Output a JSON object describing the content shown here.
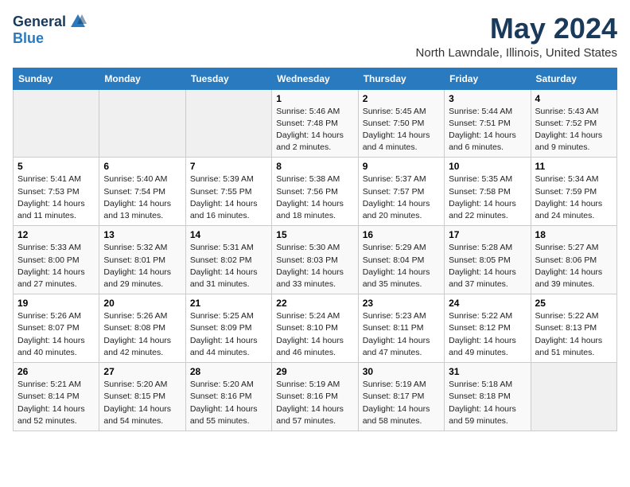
{
  "header": {
    "logo_general": "General",
    "logo_blue": "Blue",
    "month": "May 2024",
    "location": "North Lawndale, Illinois, United States"
  },
  "days_of_week": [
    "Sunday",
    "Monday",
    "Tuesday",
    "Wednesday",
    "Thursday",
    "Friday",
    "Saturday"
  ],
  "weeks": [
    [
      {
        "num": "",
        "info": ""
      },
      {
        "num": "",
        "info": ""
      },
      {
        "num": "",
        "info": ""
      },
      {
        "num": "1",
        "info": "Sunrise: 5:46 AM\nSunset: 7:48 PM\nDaylight: 14 hours\nand 2 minutes."
      },
      {
        "num": "2",
        "info": "Sunrise: 5:45 AM\nSunset: 7:50 PM\nDaylight: 14 hours\nand 4 minutes."
      },
      {
        "num": "3",
        "info": "Sunrise: 5:44 AM\nSunset: 7:51 PM\nDaylight: 14 hours\nand 6 minutes."
      },
      {
        "num": "4",
        "info": "Sunrise: 5:43 AM\nSunset: 7:52 PM\nDaylight: 14 hours\nand 9 minutes."
      }
    ],
    [
      {
        "num": "5",
        "info": "Sunrise: 5:41 AM\nSunset: 7:53 PM\nDaylight: 14 hours\nand 11 minutes."
      },
      {
        "num": "6",
        "info": "Sunrise: 5:40 AM\nSunset: 7:54 PM\nDaylight: 14 hours\nand 13 minutes."
      },
      {
        "num": "7",
        "info": "Sunrise: 5:39 AM\nSunset: 7:55 PM\nDaylight: 14 hours\nand 16 minutes."
      },
      {
        "num": "8",
        "info": "Sunrise: 5:38 AM\nSunset: 7:56 PM\nDaylight: 14 hours\nand 18 minutes."
      },
      {
        "num": "9",
        "info": "Sunrise: 5:37 AM\nSunset: 7:57 PM\nDaylight: 14 hours\nand 20 minutes."
      },
      {
        "num": "10",
        "info": "Sunrise: 5:35 AM\nSunset: 7:58 PM\nDaylight: 14 hours\nand 22 minutes."
      },
      {
        "num": "11",
        "info": "Sunrise: 5:34 AM\nSunset: 7:59 PM\nDaylight: 14 hours\nand 24 minutes."
      }
    ],
    [
      {
        "num": "12",
        "info": "Sunrise: 5:33 AM\nSunset: 8:00 PM\nDaylight: 14 hours\nand 27 minutes."
      },
      {
        "num": "13",
        "info": "Sunrise: 5:32 AM\nSunset: 8:01 PM\nDaylight: 14 hours\nand 29 minutes."
      },
      {
        "num": "14",
        "info": "Sunrise: 5:31 AM\nSunset: 8:02 PM\nDaylight: 14 hours\nand 31 minutes."
      },
      {
        "num": "15",
        "info": "Sunrise: 5:30 AM\nSunset: 8:03 PM\nDaylight: 14 hours\nand 33 minutes."
      },
      {
        "num": "16",
        "info": "Sunrise: 5:29 AM\nSunset: 8:04 PM\nDaylight: 14 hours\nand 35 minutes."
      },
      {
        "num": "17",
        "info": "Sunrise: 5:28 AM\nSunset: 8:05 PM\nDaylight: 14 hours\nand 37 minutes."
      },
      {
        "num": "18",
        "info": "Sunrise: 5:27 AM\nSunset: 8:06 PM\nDaylight: 14 hours\nand 39 minutes."
      }
    ],
    [
      {
        "num": "19",
        "info": "Sunrise: 5:26 AM\nSunset: 8:07 PM\nDaylight: 14 hours\nand 40 minutes."
      },
      {
        "num": "20",
        "info": "Sunrise: 5:26 AM\nSunset: 8:08 PM\nDaylight: 14 hours\nand 42 minutes."
      },
      {
        "num": "21",
        "info": "Sunrise: 5:25 AM\nSunset: 8:09 PM\nDaylight: 14 hours\nand 44 minutes."
      },
      {
        "num": "22",
        "info": "Sunrise: 5:24 AM\nSunset: 8:10 PM\nDaylight: 14 hours\nand 46 minutes."
      },
      {
        "num": "23",
        "info": "Sunrise: 5:23 AM\nSunset: 8:11 PM\nDaylight: 14 hours\nand 47 minutes."
      },
      {
        "num": "24",
        "info": "Sunrise: 5:22 AM\nSunset: 8:12 PM\nDaylight: 14 hours\nand 49 minutes."
      },
      {
        "num": "25",
        "info": "Sunrise: 5:22 AM\nSunset: 8:13 PM\nDaylight: 14 hours\nand 51 minutes."
      }
    ],
    [
      {
        "num": "26",
        "info": "Sunrise: 5:21 AM\nSunset: 8:14 PM\nDaylight: 14 hours\nand 52 minutes."
      },
      {
        "num": "27",
        "info": "Sunrise: 5:20 AM\nSunset: 8:15 PM\nDaylight: 14 hours\nand 54 minutes."
      },
      {
        "num": "28",
        "info": "Sunrise: 5:20 AM\nSunset: 8:16 PM\nDaylight: 14 hours\nand 55 minutes."
      },
      {
        "num": "29",
        "info": "Sunrise: 5:19 AM\nSunset: 8:16 PM\nDaylight: 14 hours\nand 57 minutes."
      },
      {
        "num": "30",
        "info": "Sunrise: 5:19 AM\nSunset: 8:17 PM\nDaylight: 14 hours\nand 58 minutes."
      },
      {
        "num": "31",
        "info": "Sunrise: 5:18 AM\nSunset: 8:18 PM\nDaylight: 14 hours\nand 59 minutes."
      },
      {
        "num": "",
        "info": ""
      }
    ]
  ]
}
